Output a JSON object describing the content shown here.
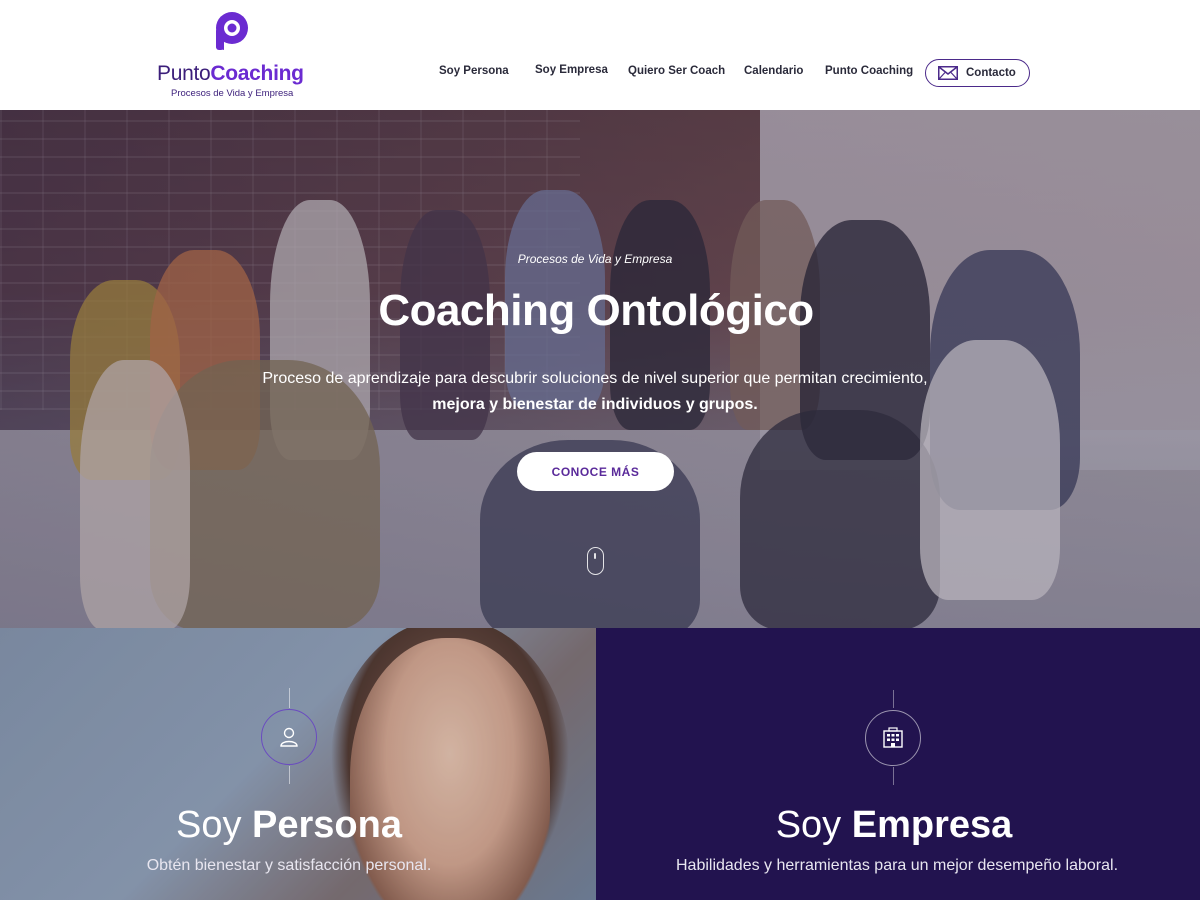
{
  "header": {
    "logo": {
      "name_light": "Punto",
      "name_bold": "Coaching",
      "tagline": "Procesos de Vida y Empresa"
    },
    "nav": [
      {
        "label": "Soy Persona"
      },
      {
        "label": "Soy Empresa"
      },
      {
        "label": "Quiero Ser Coach"
      },
      {
        "label": "Calendario"
      },
      {
        "label": "Punto Coaching"
      }
    ],
    "contact": {
      "label": "Contacto",
      "icon": "envelope-icon"
    }
  },
  "hero": {
    "kicker": "Procesos de Vida y Empresa",
    "title": "Coaching Ontológico",
    "description_line1": "Proceso de aprendizaje para descubrir soluciones de nivel superior que permitan crecimiento,",
    "description_line2": "mejora y bienestar de individuos y grupos.",
    "cta": "CONOCE MÁS",
    "scroll_icon": "mouse-scroll-icon"
  },
  "panels": {
    "persona": {
      "title_light": "Soy ",
      "title_bold": "Persona",
      "subtitle": "Obtén bienestar y satisfacción personal.",
      "icon": "person-icon"
    },
    "empresa": {
      "title_light": "Soy ",
      "title_bold": "Empresa",
      "subtitle": "Habilidades y herramientas para un mejor desempeño laboral.",
      "icon": "building-icon"
    }
  },
  "colors": {
    "brand_purple": "#6b2bd1",
    "brand_dark": "#3b1e7a",
    "empresa_bg": "#22134f",
    "accent_icon_ring": "#6a4bc0"
  }
}
